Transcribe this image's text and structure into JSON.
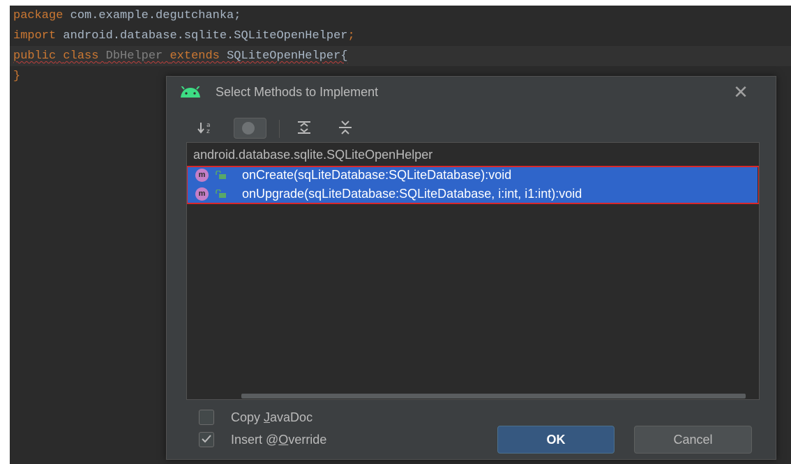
{
  "editor": {
    "lines": [
      {
        "keyword": "package",
        "rest": " com.example.degutchanka;"
      },
      {
        "keyword": "import",
        "rest": " android.database.sqlite.SQLiteOpenHelper",
        "trail": ";"
      },
      {
        "keyword": "public",
        "sp1": " ",
        "keyword2": "class",
        "sp2": " ",
        "classname": "DbHelper",
        "sp3": " ",
        "keyword3": "extends",
        "rest": " SQLiteOpenHelper{"
      },
      {
        "text": "}"
      }
    ]
  },
  "dialog": {
    "title": "Select Methods to Implement",
    "close_glyph": "✕",
    "toolbar": {
      "sort_icon": "sort-alphabetically-icon",
      "toggle_icon": "show-classes-toggle-icon",
      "expand_icon": "expand-all-icon",
      "collapse_icon": "collapse-all-icon"
    },
    "tree": {
      "header": "android.database.sqlite.SQLiteOpenHelper",
      "methods": [
        {
          "badge": "m",
          "signature": "onCreate(sqLiteDatabase:SQLiteDatabase):void"
        },
        {
          "badge": "m",
          "signature": "onUpgrade(sqLiteDatabase:SQLiteDatabase, i:int, i1:int):void"
        }
      ]
    },
    "options": {
      "copy_javadoc": {
        "pre": "Copy ",
        "mnemonic": "J",
        "post": "avaDoc",
        "checked": false
      },
      "insert_override": {
        "pre": "Insert @",
        "mnemonic": "O",
        "post": "verride",
        "checked": true
      }
    },
    "buttons": {
      "ok": "OK",
      "cancel": "Cancel"
    }
  },
  "colors": {
    "editor_bg": "#2b2b2b",
    "dialog_bg": "#3c3f41",
    "keyword": "#cc7832",
    "selection": "#2f65ca",
    "highlight_border": "#d8282b",
    "android_green": "#3ddc84"
  }
}
